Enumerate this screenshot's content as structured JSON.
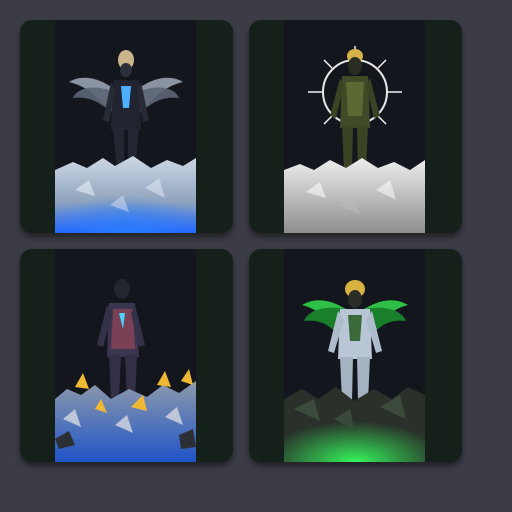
{
  "cards": [
    {
      "name": "winged-figure-blue-ice",
      "accent": "#2e7bff",
      "theme": "blue"
    },
    {
      "name": "halo-figure-mono-ice",
      "accent": "#e7e7e7",
      "theme": "mono"
    },
    {
      "name": "gold-rocks-figure",
      "accent": "#f2c233",
      "theme": "gold"
    },
    {
      "name": "winged-figure-green",
      "accent": "#34ff5e",
      "theme": "green"
    }
  ],
  "colors": {
    "page_bg": "#3c3c46",
    "card_bg": "#142019",
    "art_bg": "#12141c"
  }
}
